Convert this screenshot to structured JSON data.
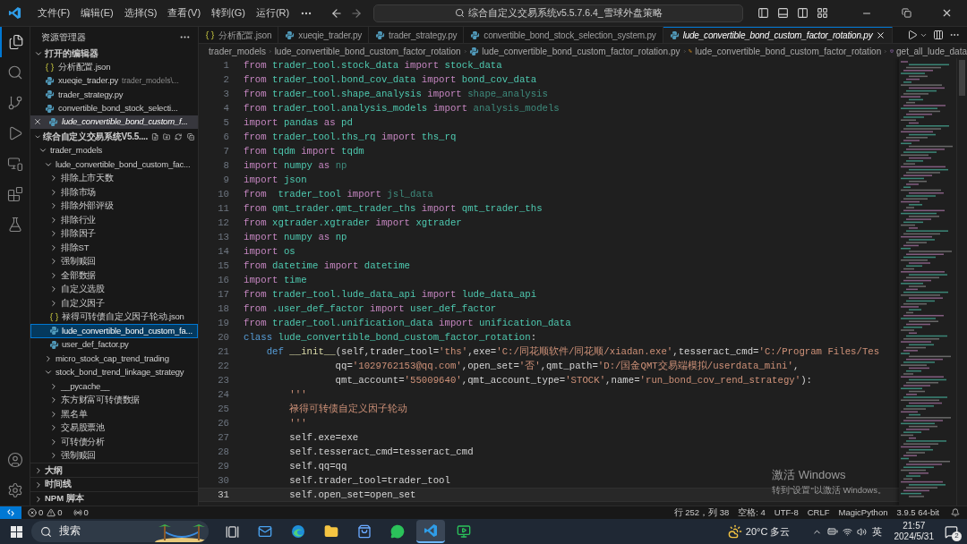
{
  "title_bar": {
    "menus": [
      "文件(F)",
      "编辑(E)",
      "选择(S)",
      "查看(V)",
      "转到(G)",
      "运行(R)"
    ],
    "title": "综合自定义交易系统v5.5.7.6.4_雪球外盘策略"
  },
  "sidebar": {
    "header": "资源管理器",
    "open_editors": {
      "title": "打开的编辑器",
      "expanded": true,
      "items": [
        {
          "label": "分析配置.json",
          "kind": "json",
          "selected": false,
          "preview": false
        },
        {
          "label": "xueqie_trader.py",
          "path": "trader_models\\...",
          "kind": "py",
          "selected": false,
          "preview": false
        },
        {
          "label": "trader_strategy.py",
          "kind": "py",
          "selected": false,
          "preview": false
        },
        {
          "label": "convertible_bond_stock_selecti...",
          "kind": "py",
          "selected": false,
          "preview": false
        },
        {
          "label": "lude_convertible_bond_custom_f...",
          "kind": "py",
          "selected": true,
          "preview": true
        }
      ]
    },
    "project": {
      "label": "综合自定义交易系统V5.5....",
      "expanded": true,
      "children": [
        {
          "label": "trader_models",
          "kind": "folder",
          "expanded": true,
          "selected": false,
          "children": [
            {
              "label": "lude_convertible_bond_custom_fac...",
              "kind": "folder",
              "expanded": true,
              "selected": false,
              "children": [
                {
                  "label": "排除上市天数",
                  "kind": "folder",
                  "expanded": false,
                  "selected": false
                },
                {
                  "label": "排除市场",
                  "kind": "folder",
                  "expanded": false,
                  "selected": false
                },
                {
                  "label": "排除外部评级",
                  "kind": "folder",
                  "expanded": false,
                  "selected": false
                },
                {
                  "label": "排除行业",
                  "kind": "folder",
                  "expanded": false,
                  "selected": false
                },
                {
                  "label": "排除因子",
                  "kind": "folder",
                  "expanded": false,
                  "selected": false
                },
                {
                  "label": "排除ST",
                  "kind": "folder",
                  "expanded": false,
                  "selected": false
                },
                {
                  "label": "强制赎回",
                  "kind": "folder",
                  "expanded": false,
                  "selected": false
                },
                {
                  "label": "全部数据",
                  "kind": "folder",
                  "expanded": false,
                  "selected": false
                },
                {
                  "label": "自定义选股",
                  "kind": "folder",
                  "expanded": false,
                  "selected": false
                },
                {
                  "label": "自定义因子",
                  "kind": "folder",
                  "expanded": false,
                  "selected": false
                },
                {
                  "label": "禄得可转债自定义因子轮动.json",
                  "kind": "json",
                  "selected": false
                },
                {
                  "label": "lude_convertible_bond_custom_fa...",
                  "kind": "py",
                  "selected": true
                },
                {
                  "label": "user_def_factor.py",
                  "kind": "py",
                  "selected": false
                }
              ]
            },
            {
              "label": "micro_stock_cap_trend_trading",
              "kind": "folder",
              "expanded": false,
              "selected": false
            },
            {
              "label": "stock_bond_trend_linkage_strategy",
              "kind": "folder",
              "expanded": true,
              "selected": false,
              "children": [
                {
                  "label": "__pycache__",
                  "kind": "folder",
                  "expanded": false,
                  "selected": false
                },
                {
                  "label": "东方财富可转债数据",
                  "kind": "folder",
                  "expanded": false,
                  "selected": false
                },
                {
                  "label": "黑名单",
                  "kind": "folder",
                  "expanded": false,
                  "selected": false
                },
                {
                  "label": "交易股票池",
                  "kind": "folder",
                  "expanded": false,
                  "selected": false
                },
                {
                  "label": "可转债分析",
                  "kind": "folder",
                  "expanded": false,
                  "selected": false
                },
                {
                  "label": "强制赎回",
                  "kind": "folder",
                  "expanded": false,
                  "selected": false
                }
              ]
            }
          ]
        }
      ]
    },
    "sections": [
      {
        "label": "大纲",
        "expanded": false
      },
      {
        "label": "时间线",
        "expanded": false
      },
      {
        "label": "NPM 脚本",
        "expanded": false
      }
    ]
  },
  "tabs": [
    {
      "label": "分析配置.json",
      "kind": "json",
      "selected": false
    },
    {
      "label": "xueqie_trader.py",
      "kind": "py",
      "selected": false
    },
    {
      "label": "trader_strategy.py",
      "kind": "py",
      "selected": false
    },
    {
      "label": "convertible_bond_stock_selection_system.py",
      "kind": "py",
      "selected": false
    },
    {
      "label": "lude_convertible_bond_custom_factor_rotation.py",
      "kind": "py",
      "selected": true
    }
  ],
  "breadcrumb": [
    {
      "label": "trader_models",
      "kind": "folder"
    },
    {
      "label": "lude_convertible_bond_custom_factor_rotation",
      "kind": "folder"
    },
    {
      "label": "lude_convertible_bond_custom_factor_rotation.py",
      "kind": "py"
    },
    {
      "label": "lude_convertible_bond_custom_factor_rotation",
      "kind": "class"
    },
    {
      "label": "get_all_lude_data",
      "kind": "method"
    }
  ],
  "code": [
    {
      "number": "1",
      "current": false,
      "tokens": [
        {
          "text": "from ",
          "kind": "kw"
        },
        {
          "text": "trader_tool.stock_data ",
          "kind": "mod"
        },
        {
          "text": "import ",
          "kind": "kw"
        },
        {
          "text": "stock_data",
          "kind": "mod"
        }
      ]
    },
    {
      "number": "2",
      "current": false,
      "tokens": [
        {
          "text": "from ",
          "kind": "kw"
        },
        {
          "text": "trader_tool.bond_cov_data ",
          "kind": "mod"
        },
        {
          "text": "import ",
          "kind": "kw"
        },
        {
          "text": "bond_cov_data",
          "kind": "mod"
        }
      ]
    },
    {
      "number": "3",
      "current": false,
      "tokens": [
        {
          "text": "from ",
          "kind": "kw"
        },
        {
          "text": "trader_tool.shape_analysis ",
          "kind": "mod"
        },
        {
          "text": "import ",
          "kind": "kw"
        },
        {
          "text": "shape_analysis",
          "kind": "unused"
        }
      ]
    },
    {
      "number": "4",
      "current": false,
      "tokens": [
        {
          "text": "from ",
          "kind": "kw"
        },
        {
          "text": "trader_tool.analysis_models ",
          "kind": "mod"
        },
        {
          "text": "import ",
          "kind": "kw"
        },
        {
          "text": "analysis_models",
          "kind": "unused"
        }
      ]
    },
    {
      "number": "5",
      "current": false,
      "tokens": [
        {
          "text": "import ",
          "kind": "kw"
        },
        {
          "text": "pandas ",
          "kind": "mod"
        },
        {
          "text": "as ",
          "kind": "kw"
        },
        {
          "text": "pd",
          "kind": "mod"
        }
      ]
    },
    {
      "number": "6",
      "current": false,
      "tokens": [
        {
          "text": "from ",
          "kind": "kw"
        },
        {
          "text": "trader_tool.ths_rq ",
          "kind": "mod"
        },
        {
          "text": "import ",
          "kind": "kw"
        },
        {
          "text": "ths_rq",
          "kind": "mod"
        }
      ]
    },
    {
      "number": "7",
      "current": false,
      "tokens": [
        {
          "text": "from ",
          "kind": "kw"
        },
        {
          "text": "tqdm ",
          "kind": "mod"
        },
        {
          "text": "import ",
          "kind": "kw"
        },
        {
          "text": "tqdm",
          "kind": "mod"
        }
      ]
    },
    {
      "number": "8",
      "current": false,
      "tokens": [
        {
          "text": "import ",
          "kind": "kw"
        },
        {
          "text": "numpy ",
          "kind": "mod"
        },
        {
          "text": "as ",
          "kind": "kw"
        },
        {
          "text": "np",
          "kind": "unused"
        }
      ]
    },
    {
      "number": "9",
      "current": false,
      "tokens": [
        {
          "text": "import ",
          "kind": "kw"
        },
        {
          "text": "json",
          "kind": "mod"
        }
      ]
    },
    {
      "number": "10",
      "current": false,
      "tokens": [
        {
          "text": "from  ",
          "kind": "kw"
        },
        {
          "text": "trader_tool ",
          "kind": "mod"
        },
        {
          "text": "import ",
          "kind": "kw"
        },
        {
          "text": "jsl_data",
          "kind": "unused"
        }
      ]
    },
    {
      "number": "11",
      "current": false,
      "tokens": [
        {
          "text": "from ",
          "kind": "kw"
        },
        {
          "text": "qmt_trader.qmt_trader_ths ",
          "kind": "mod"
        },
        {
          "text": "import ",
          "kind": "kw"
        },
        {
          "text": "qmt_trader_ths",
          "kind": "mod"
        }
      ]
    },
    {
      "number": "12",
      "current": false,
      "tokens": [
        {
          "text": "from ",
          "kind": "kw"
        },
        {
          "text": "xgtrader.xgtrader ",
          "kind": "mod"
        },
        {
          "text": "import ",
          "kind": "kw"
        },
        {
          "text": "xgtrader",
          "kind": "mod"
        }
      ]
    },
    {
      "number": "13",
      "current": false,
      "tokens": [
        {
          "text": "import ",
          "kind": "kw"
        },
        {
          "text": "numpy ",
          "kind": "mod"
        },
        {
          "text": "as ",
          "kind": "kw"
        },
        {
          "text": "np",
          "kind": "mod"
        }
      ]
    },
    {
      "number": "14",
      "current": false,
      "tokens": [
        {
          "text": "import ",
          "kind": "kw"
        },
        {
          "text": "os",
          "kind": "mod"
        }
      ]
    },
    {
      "number": "15",
      "current": false,
      "tokens": [
        {
          "text": "from ",
          "kind": "kw"
        },
        {
          "text": "datetime ",
          "kind": "mod"
        },
        {
          "text": "import ",
          "kind": "kw"
        },
        {
          "text": "datetime",
          "kind": "mod"
        }
      ]
    },
    {
      "number": "16",
      "current": false,
      "tokens": [
        {
          "text": "import ",
          "kind": "kw"
        },
        {
          "text": "time",
          "kind": "mod"
        }
      ]
    },
    {
      "number": "17",
      "current": false,
      "tokens": [
        {
          "text": "from ",
          "kind": "kw"
        },
        {
          "text": "trader_tool.lude_data_api ",
          "kind": "mod"
        },
        {
          "text": "import ",
          "kind": "kw"
        },
        {
          "text": "lude_data_api",
          "kind": "mod"
        }
      ]
    },
    {
      "number": "18",
      "current": false,
      "tokens": [
        {
          "text": "from ",
          "kind": "kw"
        },
        {
          "text": ".user_def_factor ",
          "kind": "mod"
        },
        {
          "text": "import ",
          "kind": "kw"
        },
        {
          "text": "user_def_factor",
          "kind": "mod"
        }
      ]
    },
    {
      "number": "19",
      "current": false,
      "tokens": [
        {
          "text": "from ",
          "kind": "kw"
        },
        {
          "text": "trader_tool.unification_data ",
          "kind": "mod"
        },
        {
          "text": "import ",
          "kind": "kw"
        },
        {
          "text": "unification_data",
          "kind": "mod"
        }
      ]
    },
    {
      "number": "20",
      "current": false,
      "tokens": [
        {
          "text": "class ",
          "kind": "storage"
        },
        {
          "text": "lude_convertible_bond_custom_factor_rotation",
          "kind": "mod"
        },
        {
          "text": ":",
          "kind": "plain"
        }
      ]
    },
    {
      "number": "21",
      "current": false,
      "tokens": [
        {
          "text": "    def ",
          "kind": "storage"
        },
        {
          "text": "__init__",
          "kind": "fn"
        },
        {
          "text": "(self,trader_tool=",
          "kind": "plain"
        },
        {
          "text": "'ths'",
          "kind": "str"
        },
        {
          "text": ",exe=",
          "kind": "plain"
        },
        {
          "text": "'C:/同花顺软件/同花顺/xiadan.exe'",
          "kind": "str"
        },
        {
          "text": ",tesseract_cmd=",
          "kind": "plain"
        },
        {
          "text": "'C:/Program Files/Tes",
          "kind": "str"
        }
      ]
    },
    {
      "number": "22",
      "current": false,
      "tokens": [
        {
          "text": "                qq=",
          "kind": "plain"
        },
        {
          "text": "'1029762153@qq.com'",
          "kind": "str"
        },
        {
          "text": ",open_set=",
          "kind": "plain"
        },
        {
          "text": "'否'",
          "kind": "str"
        },
        {
          "text": ",qmt_path=",
          "kind": "plain"
        },
        {
          "text": "'D:/国金QMT交易端模拟/userdata_mini'",
          "kind": "str"
        },
        {
          "text": ",",
          "kind": "plain"
        }
      ]
    },
    {
      "number": "23",
      "current": false,
      "tokens": [
        {
          "text": "                qmt_account=",
          "kind": "plain"
        },
        {
          "text": "'55009640'",
          "kind": "str"
        },
        {
          "text": ",qmt_account_type=",
          "kind": "plain"
        },
        {
          "text": "'STOCK'",
          "kind": "str"
        },
        {
          "text": ",name=",
          "kind": "plain"
        },
        {
          "text": "'run_bond_cov_rend_strategy'",
          "kind": "str"
        },
        {
          "text": "):",
          "kind": "plain"
        }
      ]
    },
    {
      "number": "24",
      "current": false,
      "tokens": [
        {
          "text": "        '''",
          "kind": "str"
        }
      ]
    },
    {
      "number": "25",
      "current": false,
      "tokens": [
        {
          "text": "        禄得可转债自定义因子轮动",
          "kind": "str"
        }
      ]
    },
    {
      "number": "26",
      "current": false,
      "tokens": [
        {
          "text": "        '''",
          "kind": "str"
        }
      ]
    },
    {
      "number": "27",
      "current": false,
      "tokens": [
        {
          "text": "        self.exe=exe",
          "kind": "plain"
        }
      ]
    },
    {
      "number": "28",
      "current": false,
      "tokens": [
        {
          "text": "        self.tesseract_cmd=tesseract_cmd",
          "kind": "plain"
        }
      ]
    },
    {
      "number": "29",
      "current": false,
      "tokens": [
        {
          "text": "        self.qq=qq",
          "kind": "plain"
        }
      ]
    },
    {
      "number": "30",
      "current": false,
      "tokens": [
        {
          "text": "        self.trader_tool=trader_tool",
          "kind": "plain"
        }
      ]
    },
    {
      "number": "31",
      "current": true,
      "tokens": [
        {
          "text": "        self.open_set=open_set",
          "kind": "plain"
        }
      ]
    }
  ],
  "activation": {
    "title": "激活 Windows",
    "subtitle": "转到\"设置\"以激活 Windows。"
  },
  "status_bar": {
    "errors": "0",
    "warnings": "0",
    "ports": "0",
    "right": [
      "行 252，列 38",
      "空格: 4",
      "UTF-8",
      "CRLF",
      "MagicPython",
      "3.9.5 64-bit"
    ]
  },
  "taskbar": {
    "search": "搜索",
    "apps": [
      {
        "kind": "taskview",
        "active": false
      },
      {
        "kind": "mail",
        "active": false
      },
      {
        "kind": "edge",
        "active": false
      },
      {
        "kind": "explorer",
        "active": false
      },
      {
        "kind": "store",
        "active": false
      },
      {
        "kind": "wechat",
        "active": false
      },
      {
        "kind": "vscode",
        "active": true
      },
      {
        "kind": "remote",
        "active": false
      }
    ],
    "weather": "20°C 多云",
    "ime": "英",
    "time": "21:57",
    "date": "2024/5/31",
    "notifications": "2"
  }
}
